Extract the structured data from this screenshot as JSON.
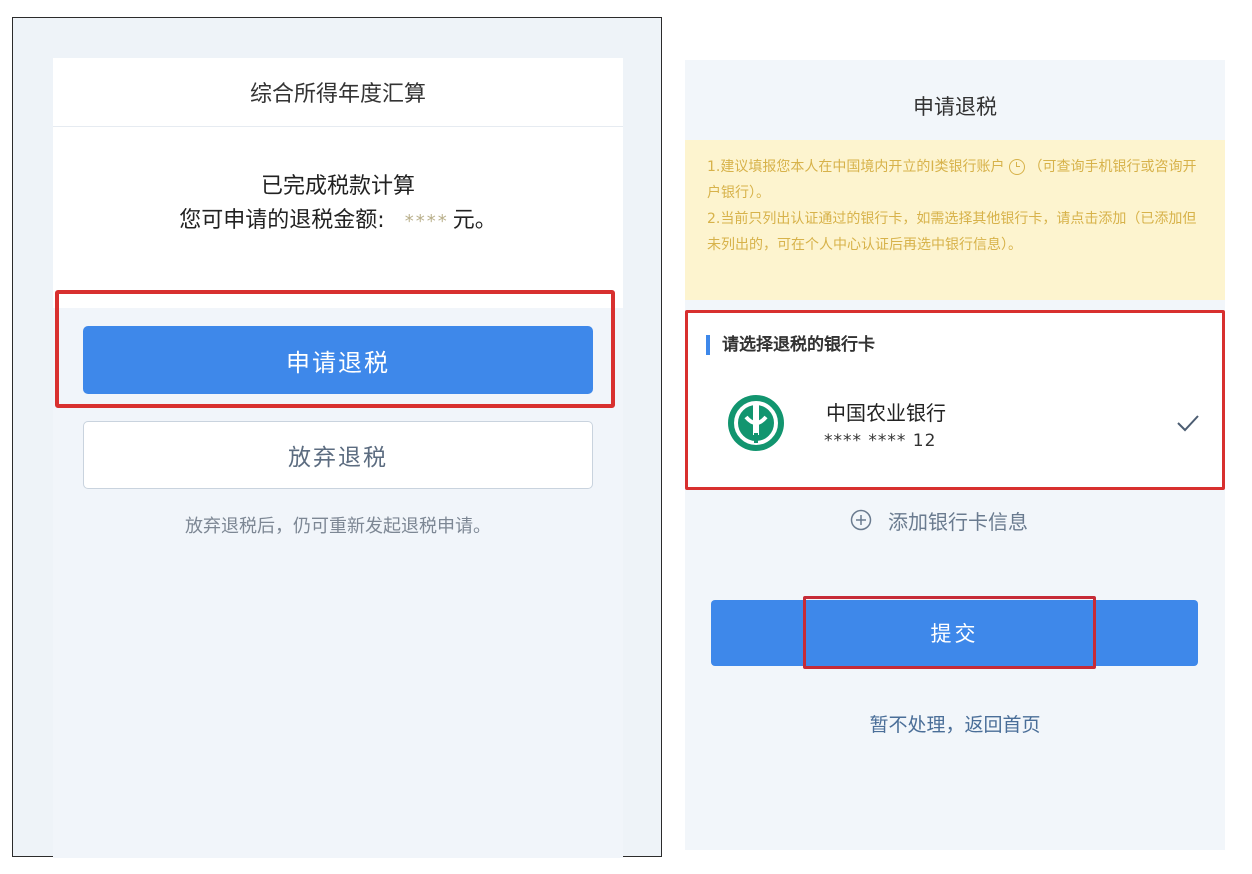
{
  "left": {
    "title": "综合所得年度汇算",
    "done_text": "已完成税款计算",
    "refund_label": "您可申请的退税金额:",
    "refund_amount": "****",
    "refund_unit": "元。",
    "apply_button": "申请退税",
    "abandon_button": "放弃退税",
    "note": "放弃退税后，仍可重新发起退税申请。"
  },
  "right": {
    "title": "申请退税",
    "notice_line1_a": "1.建议填报您本人在中国境内开立的I类银行账户",
    "notice_line1_b": "（可查询手机银行或咨询开户银行）。",
    "notice_line2": "2.当前只列出认证通过的银行卡，如需选择其他银行卡，请点击添加（已添加但未列出的，可在个人中心认证后再选中银行信息）。",
    "section_title": "请选择退税的银行卡",
    "bank_name": "中国农业银行",
    "bank_number": "**** **** 12",
    "add_card": "添加银行卡信息",
    "submit_button": "提交",
    "back_link": "暂不处理，返回首页"
  },
  "colors": {
    "primary_blue": "#3e88ea",
    "highlight_red": "#d8302f",
    "notice_bg": "#fdf4cf",
    "bank_green": "#12956f"
  },
  "icons": {
    "clock": "clock-icon",
    "bank_logo": "abc-bank-logo",
    "check": "check-icon",
    "add": "plus-circle-icon"
  }
}
